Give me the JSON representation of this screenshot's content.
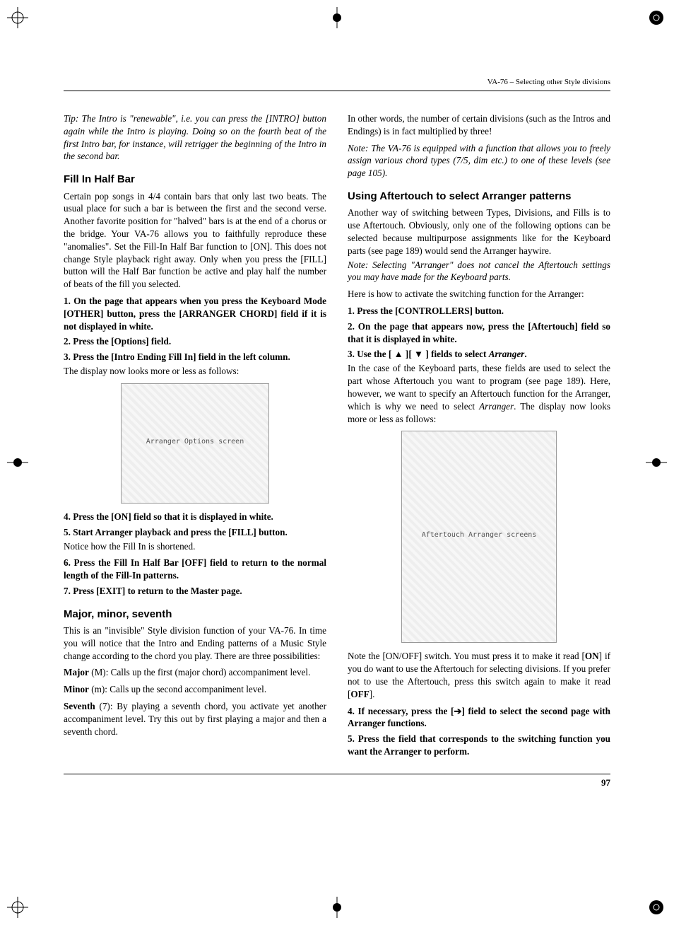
{
  "header": {
    "running": "VA-76 – Selecting other Style divisions"
  },
  "left": {
    "tip": "Tip: The Intro is \"renewable\", i.e. you can press the [INTRO] button again while the Intro is playing. Doing so on the fourth beat of the first Intro bar, for instance, will retrigger the beginning of the Intro in the second bar.",
    "h_fill": "Fill In Half Bar",
    "p_fill": "Certain pop songs in 4/4 contain bars that only last two beats. The usual place for such a bar is between the first and the second verse. Another favorite position for \"halved\" bars is at the end of a chorus or the bridge. Your VA-76 allows you to faithfully reproduce these \"anomalies\". Set the Fill-In Half Bar function to [ON]. This does not change Style playback right away. Only when you press the [FILL] button will the Half Bar function be active and play half the number of beats of the fill you selected.",
    "s1": "1. On the page that appears when you press the Keyboard Mode [OTHER] button, press the [ARRANGER CHORD] field if it is not displayed in white.",
    "s2": "2. Press the [Options] field.",
    "s3": "3. Press the [Intro Ending Fill In] field in the left column.",
    "p_disp": "The display now looks more or less as follows:",
    "img1_alt": "Arranger Options screen",
    "s4": "4. Press the [ON] field so that it is displayed in white.",
    "s5": "5. Start Arranger playback and press the [FILL] button.",
    "p_notice": "Notice how the Fill In is shortened.",
    "s6": "6. Press the Fill In Half Bar [OFF] field to return to the normal length of the Fill-In patterns.",
    "s7": "7. Press [EXIT] to return to the Master page.",
    "h_mms": "Major, minor, seventh",
    "p_mms": "This is an \"invisible\" Style division function of your VA-76. In time you will notice that the Intro and Ending patterns of a Music Style change according to the chord you play. There are three possibilities:",
    "p_major_l": "Major",
    "p_major_t": " (M): Calls up the first (major chord) accompaniment level.",
    "p_minor_l": "Minor",
    "p_minor_t": " (m): Calls up the second accompaniment level.",
    "p_seventh_l": "Seventh",
    "p_seventh_t": " (7): By playing a seventh chord, you activate yet another accompaniment level. Try this out by first playing a major and then a seventh chord."
  },
  "right": {
    "p_intro": "In other words, the number of certain divisions (such as the Intros and Endings) is in fact multiplied by three!",
    "note1": "Note: The VA-76 is equipped with a function that allows you to freely assign various chord types (7/5, dim etc.) to one of these levels (see page 105).",
    "h_aft": "Using Aftertouch to select Arranger patterns",
    "p_aft1": "Another way of switching between Types, Divisions, and Fills is to use Aftertouch. Obviously, only one of the following options can be selected because multipurpose assignments like for the Keyboard parts (see page 189) would send the Arranger haywire.",
    "note2": "Note: Selecting \"Arranger\" does not cancel the Aftertouch settings you may have made for the Keyboard parts.",
    "p_aft2": "Here is how to activate the switching function for the Arranger:",
    "s1": "1. Press the [CONTROLLERS] button.",
    "s2": "2. On the page that appears now, press the [Aftertouch] field so that it is displayed in white.",
    "s3a": "3. Use the [ ",
    "s3b": " ][ ",
    "s3c": " ] fields to select ",
    "s3d": "Arranger",
    "s3e": ".",
    "p_aft3a": "In the case of the Keyboard parts, these fields are used to select the part whose Aftertouch you want to program (see page 189). Here, however, we want to specify an Aftertouch function for the Arranger, which is why we need to select ",
    "p_aft3b": "Arranger",
    "p_aft3c": ". The display now looks more or less as follows:",
    "img2_alt": "Aftertouch Arranger screens",
    "p_note_on1": "Note the [ON/OFF] switch. You must press it to make it read [",
    "p_note_on2": "ON",
    "p_note_on3": "] if you do want to use the Aftertouch for selecting divisions. If you prefer not to use the Aftertouch, press this switch again to make it read [",
    "p_note_on4": "OFF",
    "p_note_on5": "].",
    "s4a": "4. If necessary, press the [",
    "s4b": "] field to select the second page with Arranger functions.",
    "s5": "5. Press the field that corresponds to the switching function you want the Arranger to perform."
  },
  "footer": {
    "page": "97"
  }
}
